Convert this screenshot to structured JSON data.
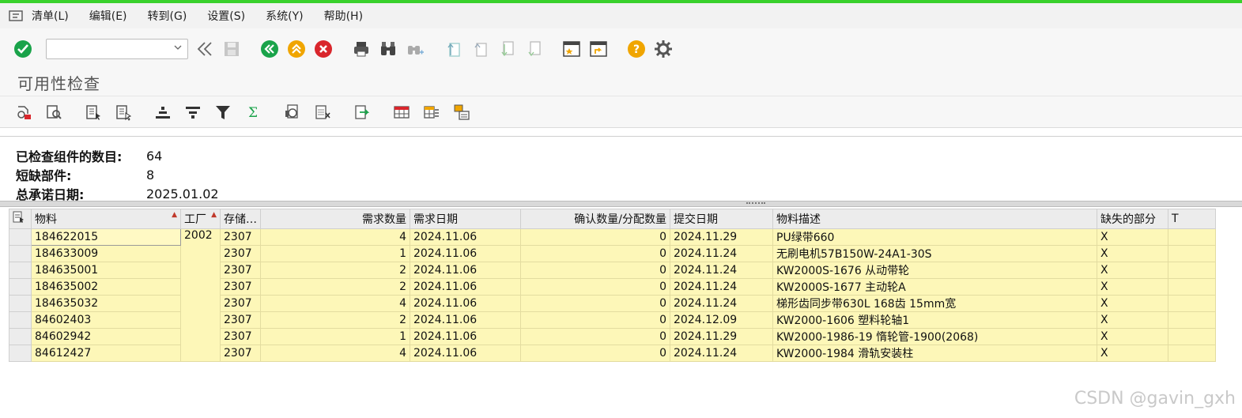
{
  "menu": {
    "items": [
      {
        "label": "清单(L)",
        "underline_key": "L"
      },
      {
        "label": "编辑(E)",
        "underline_key": "E"
      },
      {
        "label": "转到(G)",
        "underline_key": "G"
      },
      {
        "label": "设置(S)",
        "underline_key": "S"
      },
      {
        "label": "系统(Y)",
        "underline_key": "Y"
      },
      {
        "label": "帮助(H)",
        "underline_key": "H"
      }
    ]
  },
  "toolbar": {
    "command_field_value": ""
  },
  "page": {
    "title": "可用性检查"
  },
  "summary": {
    "checked_components_label": "已检查组件的数目:",
    "checked_components_value": "64",
    "shortage_label": "短缺部件:",
    "shortage_value": "8",
    "commit_date_label": "总承诺日期:",
    "commit_date_value": "2025.01.02"
  },
  "table": {
    "columns": [
      "物料",
      "工厂",
      "存储…",
      "需求数量",
      "需求日期",
      "确认数量/分配数量",
      "提交日期",
      "物料描述",
      "缺失的部分",
      "T"
    ],
    "plant": "2002",
    "rows": [
      {
        "material": "184622015",
        "storage": "2307",
        "req_qty": "4",
        "req_date": "2024.11.06",
        "conf_qty": "0",
        "commit_date": "2024.11.29",
        "description": "PU绿带660",
        "missing": "X",
        "t": ""
      },
      {
        "material": "184633009",
        "storage": "2307",
        "req_qty": "1",
        "req_date": "2024.11.06",
        "conf_qty": "0",
        "commit_date": "2024.11.24",
        "description": "无刷电机57B150W-24A1-30S",
        "missing": "X",
        "t": ""
      },
      {
        "material": "184635001",
        "storage": "2307",
        "req_qty": "2",
        "req_date": "2024.11.06",
        "conf_qty": "0",
        "commit_date": "2024.11.24",
        "description": "KW2000S-1676 从动带轮",
        "missing": "X",
        "t": ""
      },
      {
        "material": "184635002",
        "storage": "2307",
        "req_qty": "2",
        "req_date": "2024.11.06",
        "conf_qty": "0",
        "commit_date": "2024.11.24",
        "description": "KW2000S-1677 主动轮A",
        "missing": "X",
        "t": ""
      },
      {
        "material": "184635032",
        "storage": "2307",
        "req_qty": "4",
        "req_date": "2024.11.06",
        "conf_qty": "0",
        "commit_date": "2024.11.24",
        "description": "梯形齿同步带630L 168齿 15mm宽",
        "missing": "X",
        "t": ""
      },
      {
        "material": "84602403",
        "storage": "2307",
        "req_qty": "2",
        "req_date": "2024.11.06",
        "conf_qty": "0",
        "commit_date": "2024.12.09",
        "description": "KW2000-1606 塑料轮轴1",
        "missing": "X",
        "t": ""
      },
      {
        "material": "84602942",
        "storage": "2307",
        "req_qty": "1",
        "req_date": "2024.11.06",
        "conf_qty": "0",
        "commit_date": "2024.11.29",
        "description": "KW2000-1986-19 惰轮管-1900(2068)",
        "missing": "X",
        "t": ""
      },
      {
        "material": "84612427",
        "storage": "2307",
        "req_qty": "4",
        "req_date": "2024.11.06",
        "conf_qty": "0",
        "commit_date": "2024.11.24",
        "description": "KW2000-1984 滑轨安装柱",
        "missing": "X",
        "t": ""
      }
    ]
  },
  "watermark": "CSDN @gavin_gxh",
  "colors": {
    "top_accent": "#39d12c",
    "row_highlight": "#fdf7b8",
    "ok_green": "#1aa34a",
    "cancel_red": "#d9262c",
    "orange": "#f0a500"
  }
}
